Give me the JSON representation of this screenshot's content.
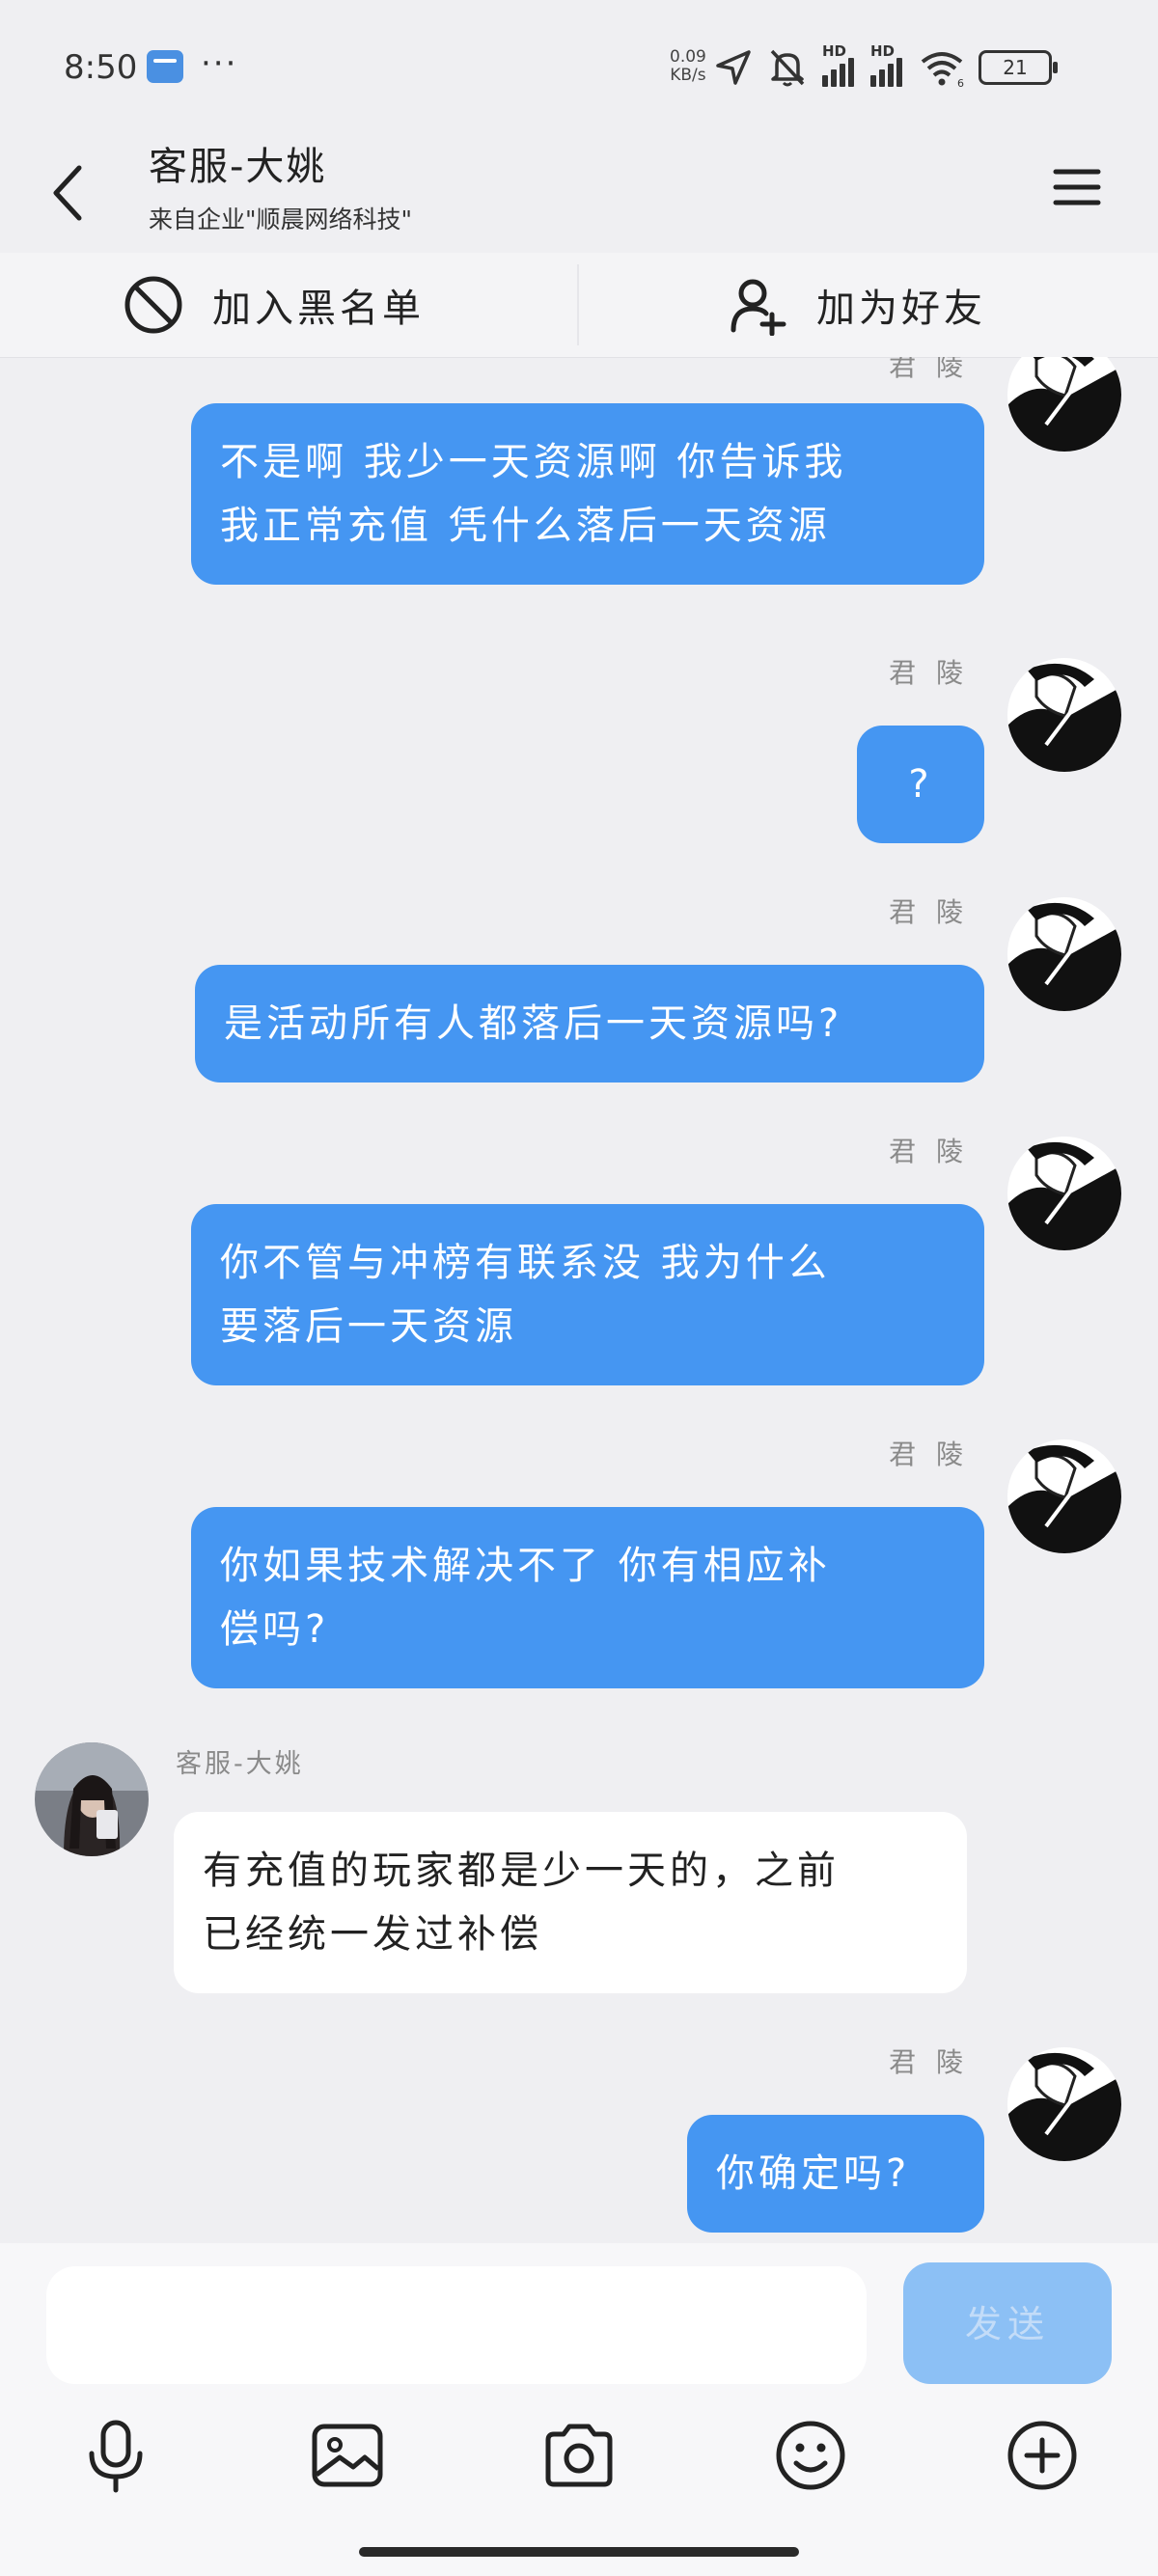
{
  "status_bar": {
    "time": "8:50",
    "net_speed_value": "0.09",
    "net_speed_unit": "KB/s",
    "battery": "21",
    "wifi_sub": "6"
  },
  "header": {
    "title": "客服-大姚",
    "subtitle": "来自企业\"顺晨网络科技\""
  },
  "actions": {
    "block_label": "加入黑名单",
    "add_friend_label": "加为好友"
  },
  "messages": [
    {
      "direction": "out",
      "sender": "君 陵",
      "lines": [
        "不是啊 我少一天资源啊 你告诉我",
        "我正常充值 凭什么落后一天资源"
      ]
    },
    {
      "direction": "out",
      "sender": "君 陵",
      "lines": [
        "?"
      ]
    },
    {
      "direction": "out",
      "sender": "君 陵",
      "lines": [
        "是活动所有人都落后一天资源吗?"
      ]
    },
    {
      "direction": "out",
      "sender": "君 陵",
      "lines": [
        "你不管与冲榜有联系没 我为什么",
        "要落后一天资源"
      ]
    },
    {
      "direction": "out",
      "sender": "君 陵",
      "lines": [
        "你如果技术解决不了 你有相应补",
        "偿吗?"
      ]
    },
    {
      "direction": "in",
      "sender": "客服-大姚",
      "lines": [
        "有充值的玩家都是少一天的，之前",
        "已经统一发过补偿"
      ]
    },
    {
      "direction": "out",
      "sender": "君 陵",
      "lines": [
        "你确定吗?"
      ]
    }
  ],
  "input": {
    "placeholder": "",
    "value": "",
    "send_label": "发送"
  },
  "colors": {
    "outgoing_bubble": "#4596f2",
    "incoming_bubble": "#ffffff",
    "background": "#efeff2",
    "send_button": "#8cc0f5"
  },
  "icons": [
    "back-icon",
    "menu-icon",
    "block-icon",
    "add-friend-icon",
    "microphone-icon",
    "image-icon",
    "camera-icon",
    "emoji-icon",
    "plus-icon"
  ]
}
